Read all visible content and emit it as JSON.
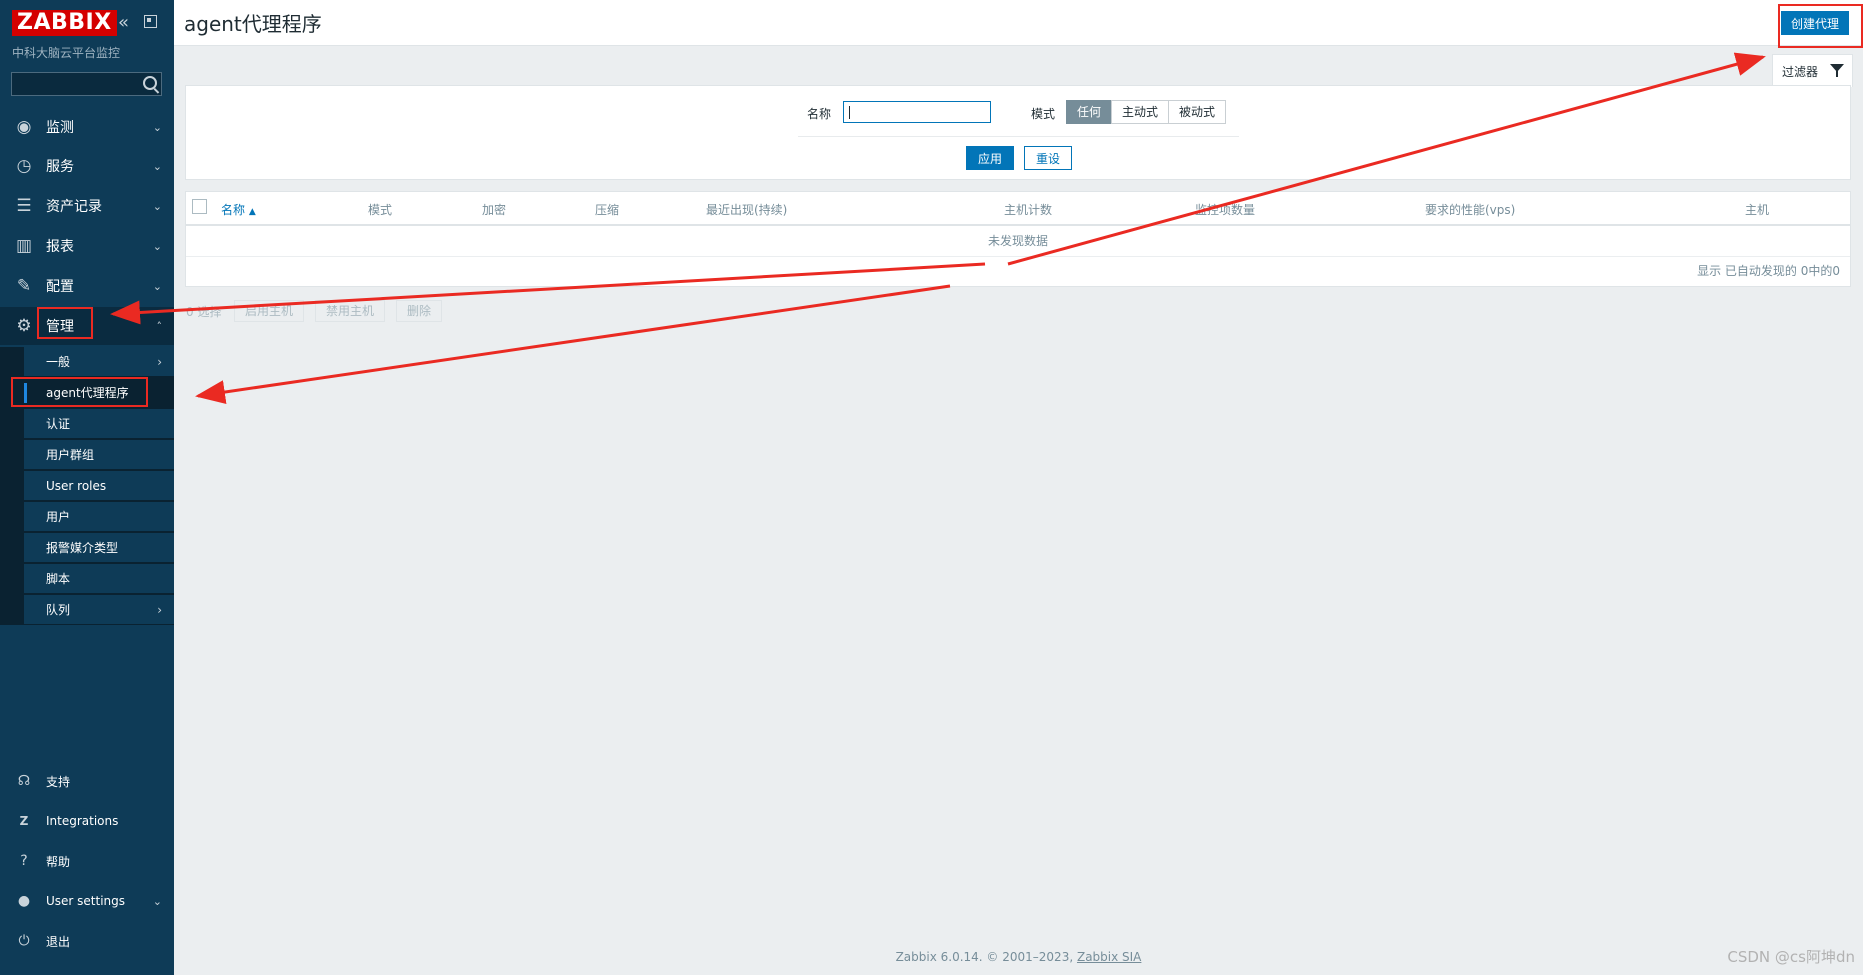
{
  "sidebar": {
    "logo": "ZABBIX",
    "brand_subtitle": "中科大脑云平台监控",
    "search_placeholder": "",
    "menu": [
      {
        "label": "监测",
        "icon": "eye-icon"
      },
      {
        "label": "服务",
        "icon": "clock-icon"
      },
      {
        "label": "资产记录",
        "icon": "list-icon"
      },
      {
        "label": "报表",
        "icon": "bar-chart-icon"
      },
      {
        "label": "配置",
        "icon": "wrench-icon"
      },
      {
        "label": "管理",
        "icon": "gear-icon"
      }
    ],
    "submenu": [
      "一般",
      "agent代理程序",
      "认证",
      "用户群组",
      "User roles",
      "用户",
      "报警媒介类型",
      "脚本",
      "队列"
    ],
    "bottom": [
      {
        "label": "支持",
        "icon": "headset-icon"
      },
      {
        "label": "Integrations",
        "icon": "z-icon"
      },
      {
        "label": "帮助",
        "icon": "help-icon"
      },
      {
        "label": "User settings",
        "icon": "user-icon"
      },
      {
        "label": "退出",
        "icon": "power-icon"
      }
    ]
  },
  "header": {
    "title": "agent代理程序",
    "create_button": "创建代理"
  },
  "filter": {
    "tab_label": "过滤器",
    "name_label": "名称",
    "name_value": "",
    "mode_label": "模式",
    "mode_options": [
      "任何",
      "主动式",
      "被动式"
    ],
    "mode_selected": "任何",
    "apply": "应用",
    "reset": "重设"
  },
  "table": {
    "columns": [
      "名称",
      "模式",
      "加密",
      "压缩",
      "最近出现(持续)",
      "主机计数",
      "监控项数量",
      "要求的性能(vps)",
      "主机"
    ],
    "sort_column": "名称",
    "empty_text": "未发现数据",
    "summary": "显示 已自动发现的 0中的0"
  },
  "mass_actions": {
    "selected": "0 选择",
    "buttons": [
      "启用主机",
      "禁用主机",
      "删除"
    ]
  },
  "footer": {
    "text": "Zabbix 6.0.14. © 2001–2023, ",
    "link": "Zabbix SIA"
  },
  "watermark": "CSDN @cs阿坤dn",
  "colors": {
    "sidebar_bg": "#0e3b57",
    "brand_red": "#d40000",
    "primary_blue": "#0275b8",
    "annotation_red": "#ea2a22"
  }
}
